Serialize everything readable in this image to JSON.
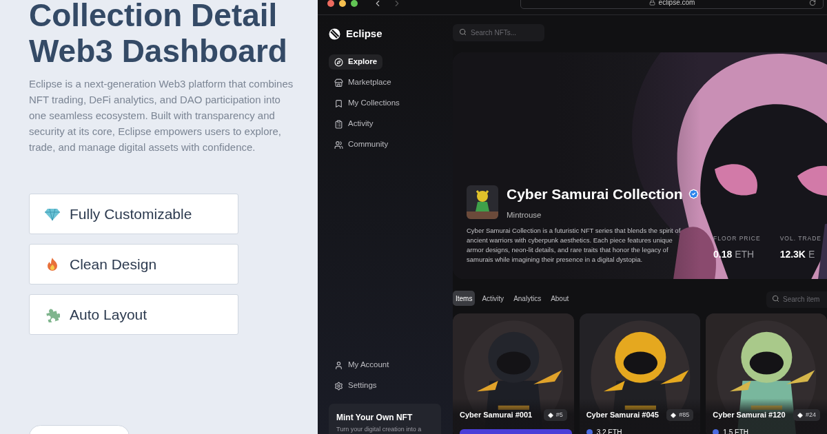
{
  "intro": {
    "title_lines": [
      "Collection Detail",
      "Web3 Dashboard"
    ],
    "description": "Eclipse is a next-generation Web3 platform that combines NFT trading, DeFi analytics, and DAO participation into one seamless ecosystem. Built with transparency and security at its core, Eclipse empowers users to explore, trade, and manage digital assets with confidence.",
    "features": [
      {
        "label": "Fully Customizable"
      },
      {
        "label": "Clean Design"
      },
      {
        "label": "Auto Layout"
      }
    ]
  },
  "browser": {
    "url": "eclipse.com"
  },
  "sidebar": {
    "brand": "Eclipse",
    "items": [
      {
        "label": "Explore",
        "selected": true
      },
      {
        "label": "Marketplace",
        "selected": false
      },
      {
        "label": "My Collections",
        "selected": false
      },
      {
        "label": "Activity",
        "selected": false
      },
      {
        "label": "Community",
        "selected": false
      }
    ],
    "bottom_items": [
      "My Account",
      "Settings"
    ],
    "promo": {
      "title": "Mint Your Own NFT",
      "text": "Turn your digital creation into a"
    }
  },
  "search": {
    "placeholder": "Search NFTs..."
  },
  "hero": {
    "name": "Cyber Samurai Collection",
    "verified": true,
    "creator": "Mintrouse",
    "description": "Cyber Samurai Collection is a futuristic NFT series that blends the spirit of ancient warriors with cyberpunk aesthetics. Each piece features unique armor designs, neon-lit details, and rare traits that honor the legacy of samurais while imagining their presence in a digital dystopia.",
    "stats": [
      {
        "label": "FLOOR PRICE",
        "value": "0.18",
        "unit": "ETH"
      },
      {
        "label": "VOL. TRADE",
        "value": "12.3K",
        "unit": "E"
      }
    ]
  },
  "tabs": [
    {
      "label": "Items",
      "selected": true
    },
    {
      "label": "Activity",
      "selected": false
    },
    {
      "label": "Analytics",
      "selected": false
    },
    {
      "label": "About",
      "selected": false
    }
  ],
  "item_search": {
    "placeholder": "Search item"
  },
  "items": [
    {
      "name": "Cyber Samurai #001",
      "rank": "#5",
      "kind": "button"
    },
    {
      "name": "Cyber Samurai #045",
      "rank": "#85",
      "kind": "price",
      "price": "3.2 ETH"
    },
    {
      "name": "Cyber Samurai #120",
      "rank": "#24",
      "kind": "price",
      "price": "1.5 ETH"
    }
  ]
}
